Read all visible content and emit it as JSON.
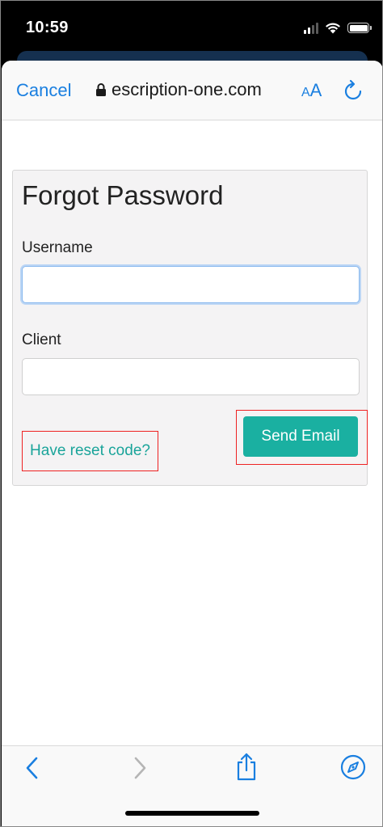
{
  "status_bar": {
    "time": "10:59",
    "icons": [
      "cellular-signal-icon",
      "wifi-icon",
      "battery-icon"
    ]
  },
  "browser": {
    "cancel_label": "Cancel",
    "url_text": "escription-one.com",
    "text_size_label_small": "A",
    "text_size_label_large": "A",
    "icons": [
      "lock-icon",
      "reload-icon"
    ],
    "accent_color": "#1a7fe0"
  },
  "form": {
    "title": "Forgot Password",
    "username_label": "Username",
    "username_value": "",
    "client_label": "Client",
    "client_value": "",
    "reset_link_label": "Have reset code?",
    "send_button_label": "Send Email",
    "button_color": "#1ab0a1",
    "link_color": "#1aa49a",
    "highlight_color": "#ee2222"
  },
  "toolbar": {
    "icons": [
      "back-icon",
      "forward-icon",
      "share-icon",
      "compass-icon"
    ]
  }
}
